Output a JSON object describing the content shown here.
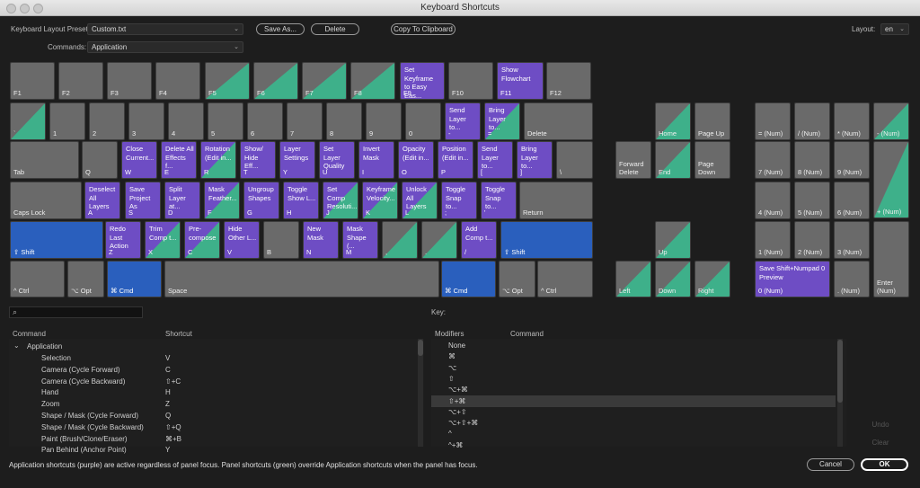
{
  "window": {
    "title": "Keyboard Shortcuts"
  },
  "toolbar": {
    "preset_label": "Keyboard Layout Preset:",
    "preset_value": "Custom.txt",
    "commands_label": "Commands:",
    "commands_value": "Application",
    "save_as": "Save As...",
    "delete": "Delete",
    "copy": "Copy To Clipboard",
    "layout_label": "Layout:",
    "layout_value": "en"
  },
  "colors": {
    "application": "#6e4dc4",
    "panel": "#3eb08a",
    "modifier": "#2a5fbd",
    "key": "#6a6a6a"
  },
  "keys": [
    {
      "id": "f1",
      "label": "F1",
      "state": "none",
      "cmd": ""
    },
    {
      "id": "f2",
      "label": "F2",
      "state": "none",
      "cmd": ""
    },
    {
      "id": "f3",
      "label": "F3",
      "state": "none",
      "cmd": ""
    },
    {
      "id": "f4",
      "label": "F4",
      "state": "none",
      "cmd": ""
    },
    {
      "id": "f5",
      "label": "F5",
      "state": "mix",
      "cmd": ""
    },
    {
      "id": "f6",
      "label": "F6",
      "state": "mix",
      "cmd": ""
    },
    {
      "id": "f7",
      "label": "F7",
      "state": "mix",
      "cmd": ""
    },
    {
      "id": "f8",
      "label": "F8",
      "state": "mix",
      "cmd": ""
    },
    {
      "id": "f9",
      "label": "F9",
      "state": "app",
      "cmd": "Set Keyframe\nto Easy Eas..."
    },
    {
      "id": "f10",
      "label": "F10",
      "state": "none",
      "cmd": ""
    },
    {
      "id": "f11",
      "label": "F11",
      "state": "app",
      "cmd": "Show\nFlowchart"
    },
    {
      "id": "f12",
      "label": "F12",
      "state": "none",
      "cmd": ""
    },
    {
      "id": "backquote",
      "label": "`",
      "state": "mix",
      "cmd": ""
    },
    {
      "id": "d1",
      "label": "1",
      "state": "none",
      "cmd": ""
    },
    {
      "id": "d2",
      "label": "2",
      "state": "none",
      "cmd": ""
    },
    {
      "id": "d3",
      "label": "3",
      "state": "none",
      "cmd": ""
    },
    {
      "id": "d4",
      "label": "4",
      "state": "none",
      "cmd": ""
    },
    {
      "id": "d5",
      "label": "5",
      "state": "none",
      "cmd": ""
    },
    {
      "id": "d6",
      "label": "6",
      "state": "none",
      "cmd": ""
    },
    {
      "id": "d7",
      "label": "7",
      "state": "none",
      "cmd": ""
    },
    {
      "id": "d8",
      "label": "8",
      "state": "none",
      "cmd": ""
    },
    {
      "id": "d9",
      "label": "9",
      "state": "none",
      "cmd": ""
    },
    {
      "id": "d0",
      "label": "0",
      "state": "none",
      "cmd": ""
    },
    {
      "id": "minus",
      "label": "-",
      "state": "app",
      "cmd": "Send\nLayer to..."
    },
    {
      "id": "equal",
      "label": "=",
      "state": "mixapp",
      "cmd": "Bring\nLayer to..."
    },
    {
      "id": "delete",
      "label": "Delete",
      "state": "none",
      "cmd": ""
    },
    {
      "id": "tab",
      "label": "Tab",
      "state": "none",
      "cmd": ""
    },
    {
      "id": "q",
      "label": "Q",
      "state": "none",
      "cmd": ""
    },
    {
      "id": "w",
      "label": "W",
      "state": "app",
      "cmd": "Close\nCurrent..."
    },
    {
      "id": "e",
      "label": "E",
      "state": "app",
      "cmd": "Delete All\nEffects f..."
    },
    {
      "id": "r",
      "label": "R",
      "state": "mixapp",
      "cmd": "Rotation\n(Edit in..."
    },
    {
      "id": "t",
      "label": "T",
      "state": "app",
      "cmd": "Show/\nHide Eff..."
    },
    {
      "id": "y",
      "label": "Y",
      "state": "app",
      "cmd": "Layer\nSettings"
    },
    {
      "id": "u",
      "label": "U",
      "state": "app",
      "cmd": "Set Layer\nQuality"
    },
    {
      "id": "i",
      "label": "I",
      "state": "app",
      "cmd": "Invert\nMask"
    },
    {
      "id": "o",
      "label": "O",
      "state": "app",
      "cmd": "Opacity\n(Edit in..."
    },
    {
      "id": "p",
      "label": "P",
      "state": "app",
      "cmd": "Position\n(Edit in..."
    },
    {
      "id": "lbracket",
      "label": "[",
      "state": "app",
      "cmd": "Send\nLayer to..."
    },
    {
      "id": "rbracket",
      "label": "]",
      "state": "app",
      "cmd": "Bring\nLayer to..."
    },
    {
      "id": "backslash",
      "label": "\\",
      "state": "none",
      "cmd": ""
    },
    {
      "id": "capslock",
      "label": "Caps Lock",
      "state": "none",
      "cmd": ""
    },
    {
      "id": "a",
      "label": "A",
      "state": "app",
      "cmd": "Deselect\nAll Layers"
    },
    {
      "id": "s",
      "label": "S",
      "state": "app",
      "cmd": "Save\nProject As"
    },
    {
      "id": "d",
      "label": "D",
      "state": "app",
      "cmd": "Split\nLayer at..."
    },
    {
      "id": "f",
      "label": "F",
      "state": "mixapp",
      "cmd": "Mask\nFeather..."
    },
    {
      "id": "g",
      "label": "G",
      "state": "app",
      "cmd": "Ungroup\nShapes"
    },
    {
      "id": "h",
      "label": "H",
      "state": "app",
      "cmd": "Toggle\nShow L..."
    },
    {
      "id": "j",
      "label": "J",
      "state": "mixapp",
      "cmd": "Set Comp\nResoluti..."
    },
    {
      "id": "k",
      "label": "K",
      "state": "mixapp",
      "cmd": "Keyframe\nVelocity..."
    },
    {
      "id": "l",
      "label": "L",
      "state": "mixapp",
      "cmd": "Unlock\nAll Layers"
    },
    {
      "id": "semicolon",
      "label": ";",
      "state": "app",
      "cmd": "Toggle\nSnap to..."
    },
    {
      "id": "quote",
      "label": "'",
      "state": "app",
      "cmd": "Toggle\nSnap to..."
    },
    {
      "id": "return",
      "label": "Return",
      "state": "none",
      "cmd": ""
    },
    {
      "id": "lshift",
      "label": "⇧ Shift",
      "state": "blue",
      "cmd": ""
    },
    {
      "id": "z",
      "label": "Z",
      "state": "app",
      "cmd": "Redo Last\nAction"
    },
    {
      "id": "x",
      "label": "X",
      "state": "mixapp",
      "cmd": "Trim\nComp t..."
    },
    {
      "id": "c",
      "label": "C",
      "state": "mixapp",
      "cmd": "Pre-\ncompose"
    },
    {
      "id": "v",
      "label": "V",
      "state": "app",
      "cmd": "Hide\nOther L..."
    },
    {
      "id": "b",
      "label": "B",
      "state": "none",
      "cmd": ""
    },
    {
      "id": "n",
      "label": "N",
      "state": "app",
      "cmd": "New\nMask"
    },
    {
      "id": "m",
      "label": "M",
      "state": "app",
      "cmd": "Mask\nShape (..."
    },
    {
      "id": "comma",
      "label": ",",
      "state": "mix",
      "cmd": ""
    },
    {
      "id": "period",
      "label": ".",
      "state": "mix",
      "cmd": ""
    },
    {
      "id": "slash",
      "label": "/",
      "state": "app",
      "cmd": "Add\nComp t..."
    },
    {
      "id": "rshift",
      "label": "⇧ Shift",
      "state": "blue",
      "cmd": ""
    },
    {
      "id": "lctrl",
      "label": "^ Ctrl",
      "state": "none",
      "cmd": ""
    },
    {
      "id": "lopt",
      "label": "⌥ Opt",
      "state": "none",
      "cmd": ""
    },
    {
      "id": "lcmd",
      "label": "⌘ Cmd",
      "state": "blue",
      "cmd": ""
    },
    {
      "id": "space",
      "label": "Space",
      "state": "none",
      "cmd": ""
    },
    {
      "id": "rcmd",
      "label": "⌘ Cmd",
      "state": "blue",
      "cmd": ""
    },
    {
      "id": "ropt",
      "label": "⌥ Opt",
      "state": "none",
      "cmd": ""
    },
    {
      "id": "rctrl",
      "label": "^ Ctrl",
      "state": "none",
      "cmd": ""
    },
    {
      "id": "home",
      "label": "Home",
      "state": "mix",
      "cmd": ""
    },
    {
      "id": "pageup",
      "label": "Page Up",
      "state": "none",
      "cmd": ""
    },
    {
      "id": "fwddelete",
      "label": "Forward\nDelete",
      "state": "none",
      "cmd": ""
    },
    {
      "id": "end",
      "label": "End",
      "state": "mix",
      "cmd": ""
    },
    {
      "id": "pagedown",
      "label": "Page\nDown",
      "state": "none",
      "cmd": ""
    },
    {
      "id": "up",
      "label": "Up",
      "state": "mix",
      "cmd": ""
    },
    {
      "id": "left",
      "label": "Left",
      "state": "mix",
      "cmd": ""
    },
    {
      "id": "down",
      "label": "Down",
      "state": "mix",
      "cmd": ""
    },
    {
      "id": "right",
      "label": "Right",
      "state": "mix",
      "cmd": ""
    },
    {
      "id": "numeq",
      "label": "= (Num)",
      "state": "none",
      "cmd": ""
    },
    {
      "id": "numdiv",
      "label": "/ (Num)",
      "state": "none",
      "cmd": ""
    },
    {
      "id": "nummul",
      "label": "* (Num)",
      "state": "none",
      "cmd": ""
    },
    {
      "id": "numminus",
      "label": "- (Num)",
      "state": "mix",
      "cmd": ""
    },
    {
      "id": "num7",
      "label": "7 (Num)",
      "state": "none",
      "cmd": ""
    },
    {
      "id": "num8",
      "label": "8 (Num)",
      "state": "none",
      "cmd": ""
    },
    {
      "id": "num9",
      "label": "9 (Num)",
      "state": "none",
      "cmd": ""
    },
    {
      "id": "numplus",
      "label": "+ (Num)",
      "state": "mix",
      "cmd": ""
    },
    {
      "id": "num4",
      "label": "4 (Num)",
      "state": "none",
      "cmd": ""
    },
    {
      "id": "num5",
      "label": "5 (Num)",
      "state": "none",
      "cmd": ""
    },
    {
      "id": "num6",
      "label": "6 (Num)",
      "state": "none",
      "cmd": ""
    },
    {
      "id": "num1",
      "label": "1 (Num)",
      "state": "none",
      "cmd": ""
    },
    {
      "id": "num2",
      "label": "2 (Num)",
      "state": "none",
      "cmd": ""
    },
    {
      "id": "num3",
      "label": "3 (Num)",
      "state": "none",
      "cmd": ""
    },
    {
      "id": "numenter",
      "label": "Enter\n(Num)",
      "state": "none",
      "cmd": ""
    },
    {
      "id": "num0",
      "label": "0 (Num)",
      "state": "app",
      "cmd": "Save Shift+Numpad 0\nPreview"
    },
    {
      "id": "numdot",
      "label": ". (Num)",
      "state": "none",
      "cmd": ""
    }
  ],
  "commands_table": {
    "header_command": "Command",
    "header_shortcut": "Shortcut",
    "group": "Application",
    "rows": [
      {
        "command": "Selection",
        "shortcut": "V"
      },
      {
        "command": "Camera (Cycle Forward)",
        "shortcut": "C"
      },
      {
        "command": "Camera (Cycle Backward)",
        "shortcut": "⇧+C"
      },
      {
        "command": "Hand",
        "shortcut": "H"
      },
      {
        "command": "Zoom",
        "shortcut": "Z"
      },
      {
        "command": "Shape / Mask (Cycle Forward)",
        "shortcut": "Q"
      },
      {
        "command": "Shape / Mask (Cycle Backward)",
        "shortcut": "⇧+Q"
      },
      {
        "command": "Paint (Brush/Clone/Eraser)",
        "shortcut": "⌘+B"
      },
      {
        "command": "Pan Behind (Anchor Point)",
        "shortcut": "Y"
      }
    ]
  },
  "key_table": {
    "title": "Key:",
    "header_modifiers": "Modifiers",
    "header_command": "Command",
    "rows": [
      "None",
      "⌘",
      "⌥",
      "⇧",
      "⌥+⌘",
      "⇧+⌘",
      "⌥+⇧",
      "⌥+⇧+⌘",
      "^",
      "^+⌘"
    ],
    "selected_index": 5
  },
  "side_buttons": {
    "undo": "Undo",
    "clear": "Clear"
  },
  "footer": {
    "note": "Application shortcuts (purple) are active regardless of panel focus. Panel shortcuts (green) override Application shortcuts when the panel has focus.",
    "cancel": "Cancel",
    "ok": "OK"
  }
}
